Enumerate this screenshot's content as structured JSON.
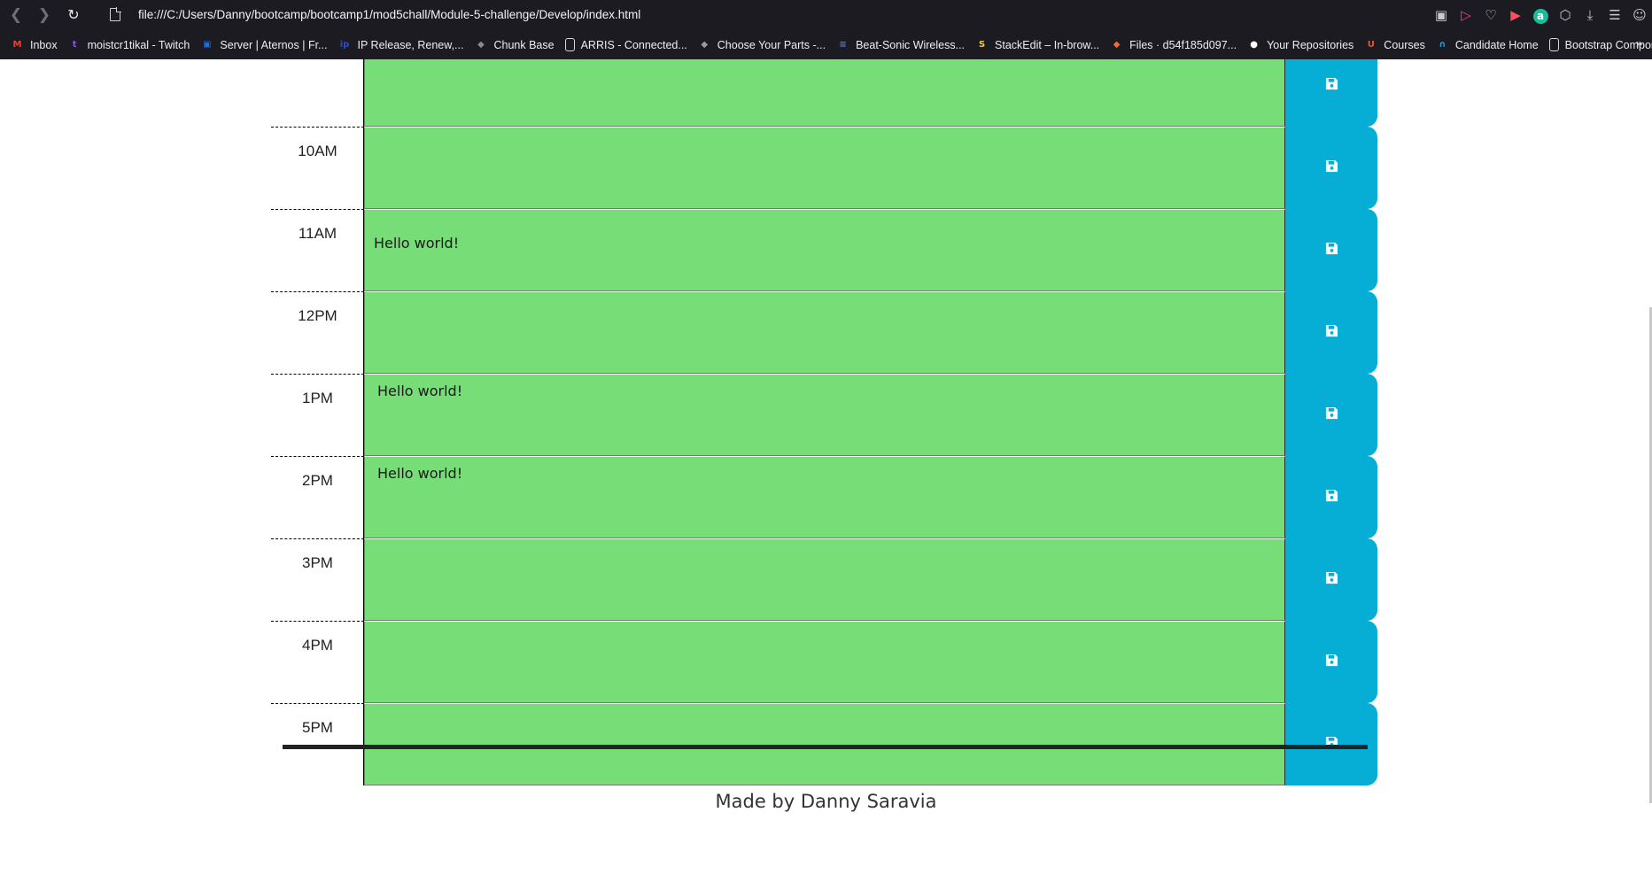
{
  "browser": {
    "url": "file:///C:/Users/Danny/bootcamp/bootcamp1/mod5chall/Module-5-challenge/Develop/index.html",
    "bookmarks": [
      {
        "label": "Inbox",
        "icon": "gmail-icon",
        "color": "#ea4335",
        "glyph": "M"
      },
      {
        "label": "moistcr1tikal - Twitch",
        "icon": "twitch-icon",
        "color": "#9146ff",
        "glyph": "t"
      },
      {
        "label": "Server | Aternos | Fr...",
        "icon": "aternos-icon",
        "color": "#1e6fd9",
        "glyph": "▣"
      },
      {
        "label": "IP Release, Renew,...",
        "icon": "ip-icon",
        "color": "#2b4fb8",
        "glyph": "ip"
      },
      {
        "label": "Chunk Base",
        "icon": "chunkbase-icon",
        "color": "#8a8a8a",
        "glyph": "◆"
      },
      {
        "label": "ARRIS - Connected...",
        "icon": "document-icon",
        "color": "#d8d8d8",
        "glyph": ""
      },
      {
        "label": "Choose Your Parts -...",
        "icon": "pcpartpicker-icon",
        "color": "#9a9a9a",
        "glyph": "◆"
      },
      {
        "label": "Beat-Sonic Wireless...",
        "icon": "beatsonic-icon",
        "color": "#5b7bdc",
        "glyph": "≡"
      },
      {
        "label": "StackEdit – In-brow...",
        "icon": "stackedit-icon",
        "color": "#f2c94c",
        "glyph": "S"
      },
      {
        "label": "Files · d54f185d097...",
        "icon": "gitlab-icon",
        "color": "#fc6d26",
        "glyph": "◆"
      },
      {
        "label": "Your Repositories",
        "icon": "github-icon",
        "color": "#ffffff",
        "glyph": "●"
      },
      {
        "label": "Courses",
        "icon": "courses-icon",
        "color": "#e4572e",
        "glyph": "U"
      },
      {
        "label": "Candidate Home",
        "icon": "candidate-icon",
        "color": "#2d9cdb",
        "glyph": "∩"
      },
      {
        "label": "Bootstrap Compon...",
        "icon": "document-icon",
        "color": "#d8d8d8",
        "glyph": ""
      }
    ]
  },
  "schedule": {
    "rows": [
      {
        "hour": "",
        "text": ""
      },
      {
        "hour": "10AM",
        "text": ""
      },
      {
        "hour": "11AM",
        "text": "Hello world!"
      },
      {
        "hour": "12PM",
        "text": ""
      },
      {
        "hour": "1PM",
        "text": " Hello world!"
      },
      {
        "hour": "2PM",
        "text": " Hello world!"
      },
      {
        "hour": "3PM",
        "text": ""
      },
      {
        "hour": "4PM",
        "text": ""
      },
      {
        "hour": "5PM",
        "text": ""
      }
    ],
    "colors": {
      "present_row": "#77dd77",
      "save_button": "#06aed5"
    }
  },
  "footer": {
    "text": "Made by Danny Saravia"
  }
}
